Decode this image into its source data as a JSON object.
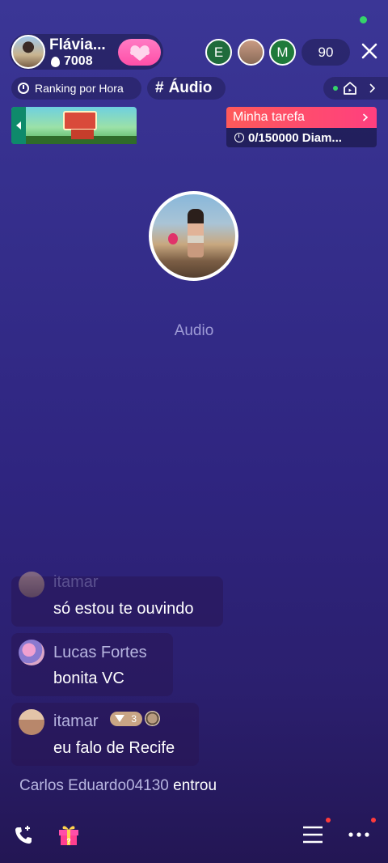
{
  "host": {
    "name": "Flávia...",
    "score": "7008"
  },
  "viewers": {
    "items": [
      {
        "initial": "E",
        "color": "#1f6b3c"
      },
      {
        "initial": "",
        "color": "#8a6b58"
      },
      {
        "initial": "M",
        "color": "#1f7a3b"
      }
    ],
    "count": "90"
  },
  "ranking": {
    "label": "Ranking por Hora"
  },
  "topic": {
    "label": "Áudio"
  },
  "task": {
    "title": "Minha tarefa",
    "progress": "0/150000 Diam..."
  },
  "stage": {
    "label": "Audio"
  },
  "chat": {
    "messages": [
      {
        "user": "itamar",
        "text": "só estou te ouvindo"
      },
      {
        "user": "Lucas Fortes",
        "text": "bonita VC"
      },
      {
        "user": "itamar",
        "text": "eu falo de Recife",
        "level": "3"
      }
    ],
    "join": {
      "name": "Carlos Eduardo04130",
      "action": "entrou"
    }
  },
  "colors": {
    "accent_pink": "#ff4fa8",
    "task_red": "#ff3f7f",
    "online_green": "#35d46a"
  }
}
